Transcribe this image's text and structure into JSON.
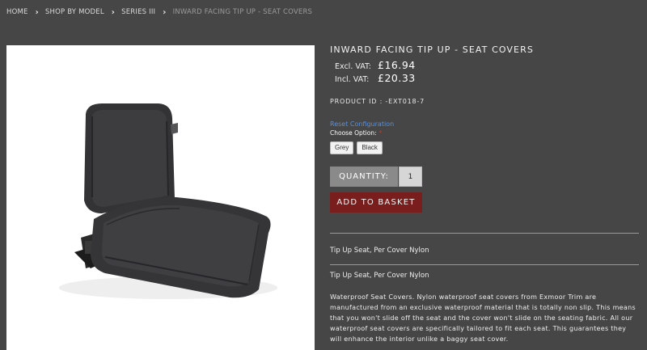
{
  "breadcrumb": {
    "items": [
      {
        "label": "HOME"
      },
      {
        "label": "SHOP BY MODEL"
      },
      {
        "label": "SERIES III"
      },
      {
        "label": "INWARD FACING TIP UP - SEAT COVERS"
      }
    ]
  },
  "product": {
    "title": "INWARD FACING TIP UP - SEAT COVERS",
    "price_excl_label": "Excl. VAT:",
    "price_excl": "£16.94",
    "price_incl_label": "Incl. VAT:",
    "price_incl": "£20.33",
    "product_id": "PRODUCT ID : -EXT018-7",
    "image_icon": "seat-cover-photo"
  },
  "config": {
    "reset_label": "Reset Configuration",
    "choose_label": "Choose Option:",
    "required_mark": "*",
    "options": [
      "Grey",
      "Black"
    ]
  },
  "cart": {
    "quantity_label": "QUANTITY:",
    "quantity_value": "1",
    "add_label": "ADD TO BASKET"
  },
  "description": {
    "short_1": "Tip Up Seat, Per Cover Nylon",
    "short_2": "Tip Up Seat, Per Cover Nylon",
    "long": "Waterproof Seat Covers. Nylon waterproof seat covers from Exmoor Trim are manufactured from an exclusive waterproof material that is totally non slip. This means that you won't slide off the seat and the cover won't slide on the seating fabric. All our waterproof seat covers are specifically tailored to fit each seat. This guarantees they will enhance the interior unlike a baggy seat cover."
  },
  "colors": {
    "background": "#464646",
    "basket_button": "#7a1d1d",
    "quantity_label_bg": "#8a8a8a",
    "link": "#5c8fd6",
    "required": "#c0392b"
  }
}
